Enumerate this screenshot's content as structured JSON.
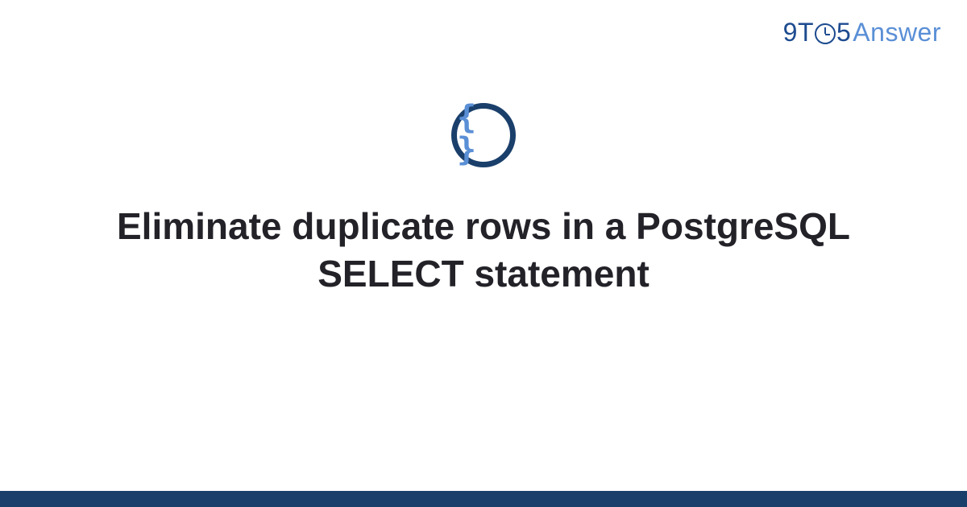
{
  "brand": {
    "part1": "9",
    "part2": "T",
    "part3": "5",
    "part4": "Answer"
  },
  "icon": {
    "glyph": "{ }"
  },
  "title": "Eliminate duplicate rows in a PostgreSQL SELECT statement",
  "colors": {
    "brand_dark": "#1a3f6b",
    "brand_mid": "#1d4b8f",
    "brand_light": "#5a8fd6"
  }
}
